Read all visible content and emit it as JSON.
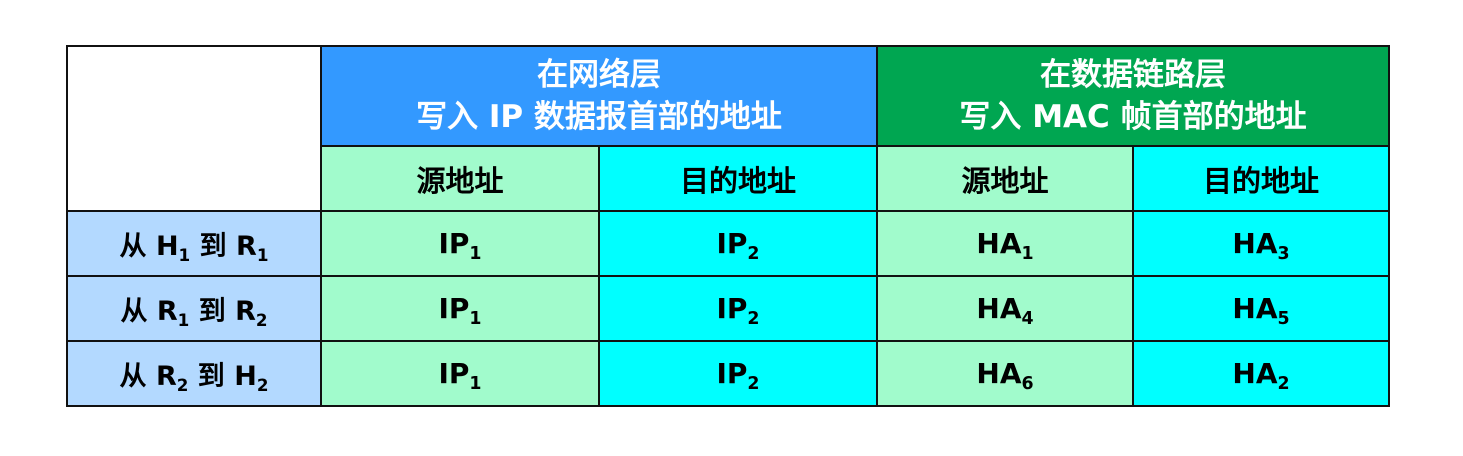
{
  "table": {
    "group_headers": [
      {
        "line1": "在网络层",
        "line2": "写入 IP 数据报首部的地址"
      },
      {
        "line1": "在数据链路层",
        "line2": "写入 MAC 帧首部的地址"
      }
    ],
    "sub_headers": [
      "源地址",
      "目的地址",
      "源地址",
      "目的地址"
    ],
    "rows": [
      {
        "label": {
          "pre": "从 ",
          "a": "H",
          "a_sub": "1",
          "mid": " 到 ",
          "b": "R",
          "b_sub": "1"
        },
        "cells": [
          {
            "base": "IP",
            "sub": "1"
          },
          {
            "base": "IP",
            "sub": "2"
          },
          {
            "base": "HA",
            "sub": "1"
          },
          {
            "base": "HA",
            "sub": "3"
          }
        ]
      },
      {
        "label": {
          "pre": "从 ",
          "a": "R",
          "a_sub": "1",
          "mid": " 到 ",
          "b": "R",
          "b_sub": "2"
        },
        "cells": [
          {
            "base": "IP",
            "sub": "1"
          },
          {
            "base": "IP",
            "sub": "2"
          },
          {
            "base": "HA",
            "sub": "4"
          },
          {
            "base": "HA",
            "sub": "5"
          }
        ]
      },
      {
        "label": {
          "pre": "从 ",
          "a": "R",
          "a_sub": "2",
          "mid": " 到 ",
          "b": "H",
          "b_sub": "2"
        },
        "cells": [
          {
            "base": "IP",
            "sub": "1"
          },
          {
            "base": "IP",
            "sub": "2"
          },
          {
            "base": "HA",
            "sub": "6"
          },
          {
            "base": "HA",
            "sub": "2"
          }
        ]
      }
    ],
    "colors": {
      "ip_group": "#3399ff",
      "mac_group": "#00a651",
      "source_column": "#a1fbcc",
      "destination_column": "#00ffff",
      "row_label": "#b3d9ff",
      "border": "#111111"
    }
  }
}
